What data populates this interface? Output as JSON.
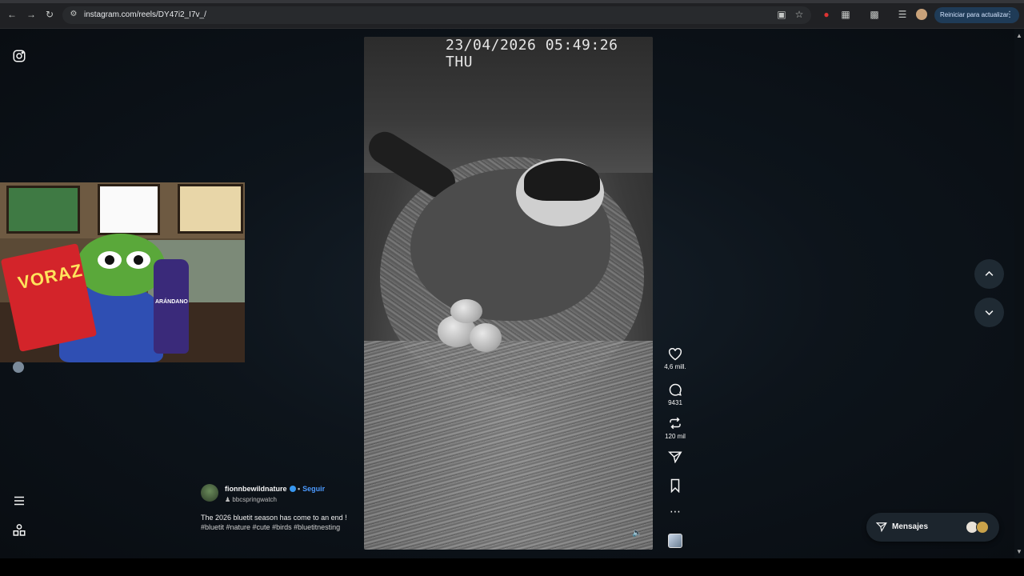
{
  "browser": {
    "url": "instagram.com/reels/DY47i2_I7v_/",
    "update_button": "Reiniciar para actualizar",
    "icons": [
      "back-icon",
      "forward-icon",
      "reload-icon",
      "site-info-icon",
      "cast-icon",
      "star-icon",
      "extension-icon",
      "puzzle-icon",
      "tab-search-icon",
      "media-icon",
      "profile-icon",
      "menu-icon"
    ]
  },
  "video": {
    "timestamp": "23/04/2026 05:49:26 THU"
  },
  "actions": {
    "likes": "4,6 mill.",
    "comments": "9431",
    "reposts": "120 mil"
  },
  "caption": {
    "username": "fionnbewildnature",
    "follow": "Seguir",
    "audio": "bbcspringwatch",
    "text": "The 2026 bluetit season has come to an end !",
    "tags": "#bluetit #nature #cute #birds #bluetitnesting"
  },
  "meme": {
    "bag_text": "VORAZ",
    "bottle_text": "ARÁNDANO"
  },
  "messages": {
    "label": "Mensajes"
  },
  "colors": {
    "background": "#0d141b",
    "accent_link": "#4c9aff",
    "verified": "#3897f0",
    "update_button_bg": "#1f3b57"
  }
}
